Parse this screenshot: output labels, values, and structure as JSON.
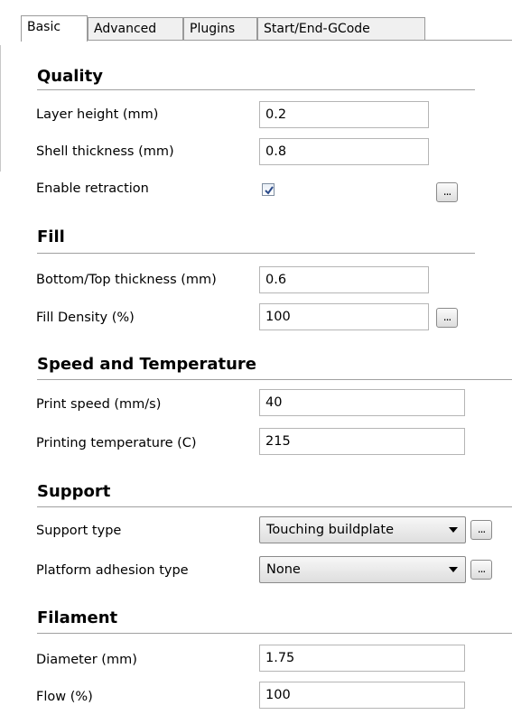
{
  "tabs": [
    {
      "label": "Basic"
    },
    {
      "label": "Advanced"
    },
    {
      "label": "Plugins"
    },
    {
      "label": "Start/End-GCode"
    }
  ],
  "sections": {
    "quality": {
      "title": "Quality",
      "layer_height": {
        "label": "Layer height (mm)",
        "value": "0.2"
      },
      "shell_thickness": {
        "label": "Shell thickness (mm)",
        "value": "0.8"
      },
      "enable_retraction": {
        "label": "Enable retraction",
        "checked": true
      }
    },
    "fill": {
      "title": "Fill",
      "bottom_top_thickness": {
        "label": "Bottom/Top thickness (mm)",
        "value": "0.6"
      },
      "fill_density": {
        "label": "Fill Density (%)",
        "value": "100"
      }
    },
    "speed": {
      "title": "Speed and Temperature",
      "print_speed": {
        "label": "Print speed (mm/s)",
        "value": "40"
      },
      "printing_temperature": {
        "label": "Printing temperature (C)",
        "value": "215"
      }
    },
    "support": {
      "title": "Support",
      "support_type": {
        "label": "Support type",
        "value": "Touching buildplate"
      },
      "platform_adhesion": {
        "label": "Platform adhesion type",
        "value": "None"
      }
    },
    "filament": {
      "title": "Filament",
      "diameter": {
        "label": "Diameter (mm)",
        "value": "1.75"
      },
      "flow": {
        "label": "Flow (%)",
        "value": "100"
      }
    }
  },
  "more_button_label": "...",
  "icons": {
    "checkbox_check": "check-icon",
    "dropdown_arrow": "chevron-down-icon"
  }
}
